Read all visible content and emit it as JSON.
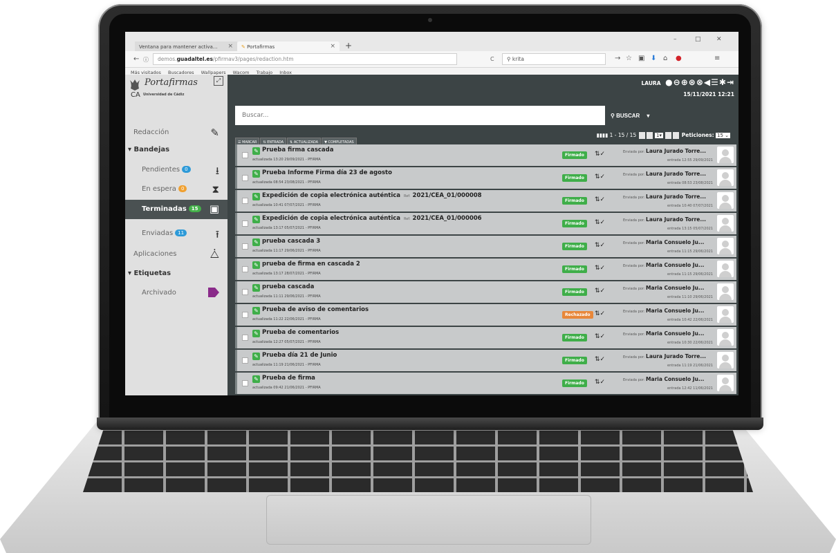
{
  "browser": {
    "tabs": [
      {
        "label": "Ventana para mantener activa..."
      },
      {
        "label": "Portafirmas"
      }
    ],
    "url_prefix": "demos.",
    "url_host": "guadaltel.es",
    "url_path": "/pfirmav3/pages/redaction.htm",
    "search_value": "krita",
    "bookmarks": [
      "Más visitados",
      "Buscadores",
      "Wallpapers",
      "Wacom",
      "Trabajo",
      "Inbox"
    ]
  },
  "app": {
    "logo_name": "Portafirmas",
    "logo_ca": "CA",
    "logo_univ": "Universidad de Cádiz",
    "user": "LAURA",
    "datetime": "15/11/2021 12:21",
    "search_placeholder": "Buscar...",
    "search_button": "BUSCAR"
  },
  "sidebar": {
    "redaccion": "Redacción",
    "bandejas": "Bandejas",
    "pendientes": "Pendientes",
    "pendientes_count": "0",
    "espera": "En espera",
    "espera_count": "0",
    "terminadas": "Terminadas",
    "terminadas_count": "15",
    "enviadas": "Enviadas",
    "enviadas_count": "11",
    "aplicaciones": "Aplicaciones",
    "etiquetas": "Etiquetas",
    "archivado": "Archivado"
  },
  "toolbar": {
    "marcar": "MARCAR",
    "entrada": "ENTRADA",
    "actualizada": "ACTUALIZADA",
    "completadas": "COMPLETADAS"
  },
  "pager": {
    "range": "1 - 15 / 15",
    "page": "1",
    "peticiones_label": "Peticiones:",
    "peticiones_value": "15"
  },
  "rows": [
    {
      "title": "Prueba firma cascada",
      "ref_label": "",
      "ref": "",
      "meta": "actualizada 13:20 29/09/2021 - PFIRMA",
      "status": "Firmado",
      "sent_label": "Enviada por:",
      "sender": "Laura Jurado Torre...",
      "entry": "entrada 12:55 29/09/2021"
    },
    {
      "title": "Prueba Informe Firma día 23 de agosto",
      "ref_label": "",
      "ref": "",
      "meta": "actualizada 08:54 23/08/2021 - PFIRMA",
      "status": "Firmado",
      "sent_label": "Enviada por:",
      "sender": "Laura Jurado Torre...",
      "entry": "entrada 08:53 23/08/2021"
    },
    {
      "title": "Expedición de copia electrónica auténtica",
      "ref_label": "Ref:",
      "ref": "2021/CEA_01/000008",
      "meta": "actualizada 10:41 07/07/2021 - PFIRMA",
      "status": "Firmado",
      "sent_label": "Enviada por:",
      "sender": "Laura Jurado Torre...",
      "entry": "entrada 10:40 07/07/2021"
    },
    {
      "title": "Expedición de copia electrónica auténtica",
      "ref_label": "Ref:",
      "ref": "2021/CEA_01/000006",
      "meta": "actualizada 13:17 05/07/2021 - PFIRMA",
      "status": "Firmado",
      "sent_label": "Enviada por:",
      "sender": "Laura Jurado Torre...",
      "entry": "entrada 13:15 05/07/2021"
    },
    {
      "title": "prueba cascada 3",
      "ref_label": "",
      "ref": "",
      "meta": "actualizada 11:17 29/06/2021 - PFIRMA",
      "status": "Firmado",
      "sent_label": "Enviada por:",
      "sender": "Maria Consuelo Ju...",
      "entry": "entrada 11:15 29/06/2021"
    },
    {
      "title": "prueba de firma en cascada 2",
      "ref_label": "",
      "ref": "",
      "meta": "actualizada 13:17 28/07/2021 - PFIRMA",
      "status": "Firmado",
      "sent_label": "Enviada por:",
      "sender": "Maria Consuelo Ju...",
      "entry": "entrada 11:15 29/06/2021"
    },
    {
      "title": "prueba cascada",
      "ref_label": "",
      "ref": "",
      "meta": "actualizada 11:11 29/06/2021 - PFIRMA",
      "status": "Firmado",
      "sent_label": "Enviada por:",
      "sender": "Maria Consuelo Ju...",
      "entry": "entrada 11:10 29/06/2021"
    },
    {
      "title": "Prueba de aviso de comentarios",
      "ref_label": "",
      "ref": "",
      "meta": "actualizada 11:22 22/06/2021 - PFIRMA",
      "status": "Rechazado",
      "sent_label": "Enviada por:",
      "sender": "Maria Consuelo Ju...",
      "entry": "entrada 10:42 22/06/2021"
    },
    {
      "title": "Prueba de comentarios",
      "ref_label": "",
      "ref": "",
      "meta": "actualizada 12:27 05/07/2021 - PFIRMA",
      "status": "Firmado",
      "sent_label": "Enviada por:",
      "sender": "Maria Consuelo Ju...",
      "entry": "entrada 10:30 22/06/2021"
    },
    {
      "title": "Prueba día 21 de Junio",
      "ref_label": "",
      "ref": "",
      "meta": "actualizada 11:19 21/06/2021 - PFIRMA",
      "status": "Firmado",
      "sent_label": "Enviada por:",
      "sender": "Laura Jurado Torre...",
      "entry": "entrada 11:19 21/06/2021"
    },
    {
      "title": "Prueba de firma",
      "ref_label": "",
      "ref": "",
      "meta": "actualizada 09:42 21/06/2021 - PFIRMA",
      "status": "Firmado",
      "sent_label": "Enviada por:",
      "sender": "Maria Consuelo Ju...",
      "entry": "entrada 12:42 11/06/2021"
    }
  ],
  "colors": {
    "firmado": "#3fae49",
    "rechazado": "#e8873a",
    "header": "#3c4445",
    "badge_blue": "#2d9ad8"
  }
}
